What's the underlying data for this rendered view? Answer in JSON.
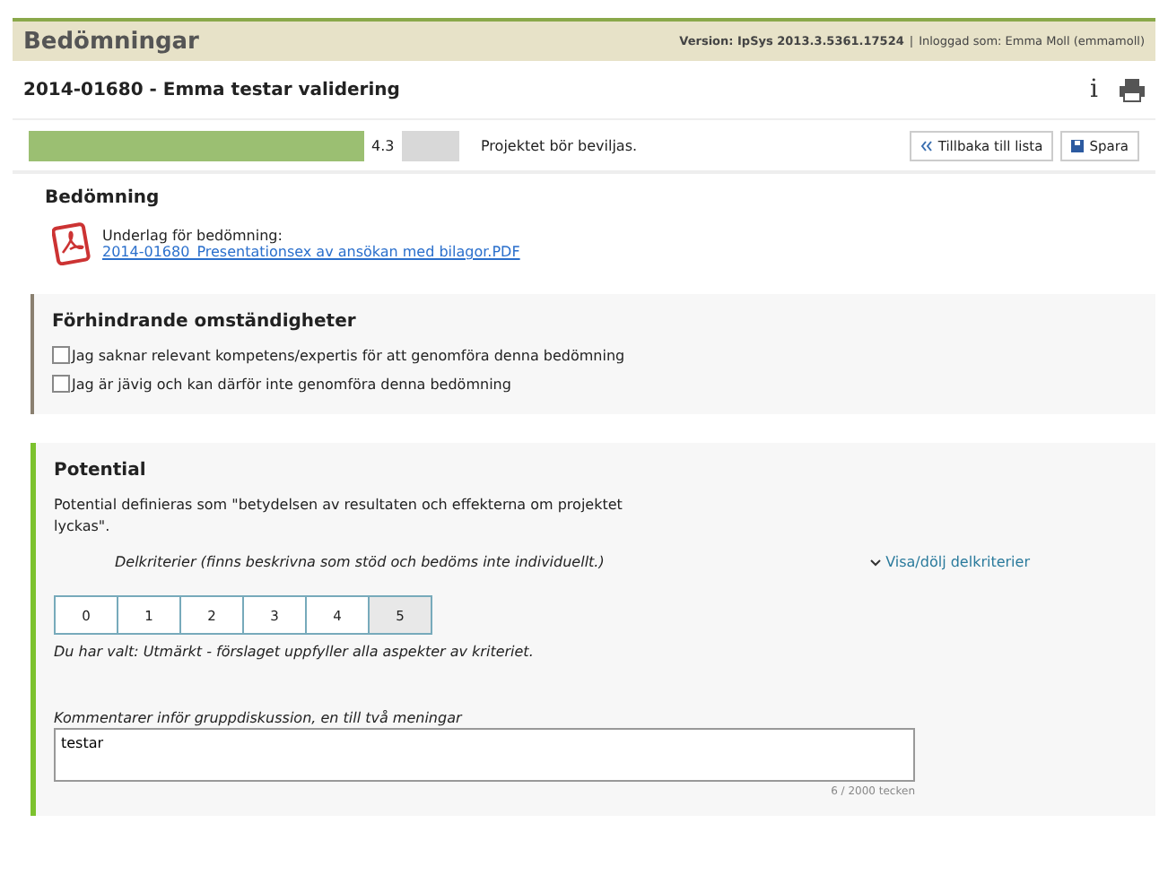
{
  "header": {
    "title": "Bedömningar",
    "version": "Version: IpSys 2013.3.5361.17524",
    "separator": "|",
    "user": "Inloggad som: Emma Moll (emmamoll)"
  },
  "project": {
    "title": "2014-01680 - Emma testar validering",
    "info_icon": "i"
  },
  "score": {
    "value": "4.3",
    "recommendation": "Projektet bör beviljas."
  },
  "buttons": [
    {
      "label": "Tillbaka till lista",
      "kind": "back"
    },
    {
      "label": "Spara",
      "kind": "save"
    }
  ],
  "assessment": {
    "title": "Bedömning",
    "basis_label": "Underlag för bedömning:",
    "file_link": "2014-01680_Presentationsex av ansökan med bilagor.PDF"
  },
  "obstacles": {
    "title": "Förhindrande omständigheter",
    "options": [
      {
        "label": "Jag saknar relevant kompetens/expertis för att genomföra denna bedömning",
        "checked": false
      },
      {
        "label": "Jag är jävig och kan därför inte genomföra denna bedömning",
        "checked": false
      }
    ]
  },
  "potential": {
    "title": "Potential",
    "description": "Potential definieras som \"betydelsen av resultaten och effekterna om projektet lyckas\".",
    "subcriteria": "Delkriterier (finns beskrivna som stöd och bedöms inte individuellt.)",
    "toggle": "Visa/dölj delkriterier",
    "grades": [
      {
        "label": "0",
        "selected": false
      },
      {
        "label": "1",
        "selected": false
      },
      {
        "label": "2",
        "selected": false
      },
      {
        "label": "3",
        "selected": false
      },
      {
        "label": "4",
        "selected": false
      },
      {
        "label": "5",
        "selected": true
      }
    ],
    "chosen": "Du har valt: Utmärkt - förslaget uppfyller alla aspekter av kriteriet.",
    "comment_label": "Kommentarer inför gruppdiskussion, en till två meningar",
    "comment_value": "testar",
    "counter": "6 / 2000 tecken"
  }
}
